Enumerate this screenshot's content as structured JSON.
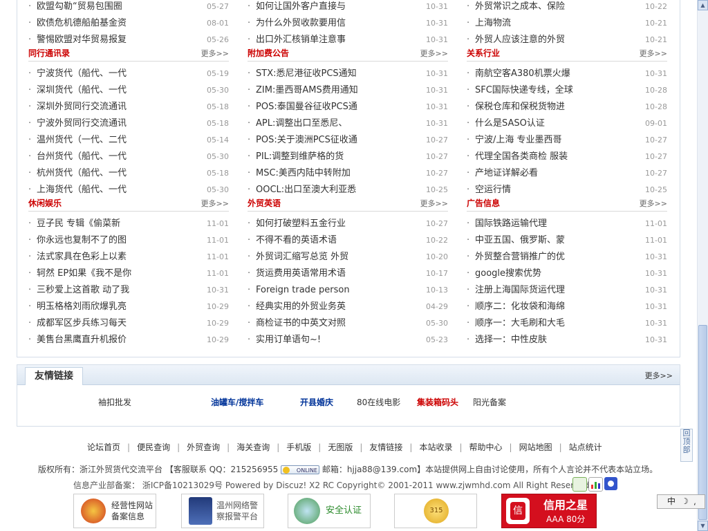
{
  "sections": {
    "col1_top": [
      {
        "title": "欧盟勾勒“贸易包围圈",
        "date": "05-27"
      },
      {
        "title": "欧债危机德船舶基金资",
        "date": "08-01"
      },
      {
        "title": "警惕欧盟对华贸易报复",
        "date": "05-26"
      }
    ],
    "col2_top": [
      {
        "title": "如何让国外客户直接与",
        "date": "10-31"
      },
      {
        "title": "为什么外贸收款要用信",
        "date": "10-31"
      },
      {
        "title": "出口外汇核销单注意事",
        "date": "10-31"
      }
    ],
    "col3_top": [
      {
        "title": "外贸常识之成本、保险",
        "date": "10-22"
      },
      {
        "title": "上海物流",
        "date": "10-21"
      },
      {
        "title": "外贸人应该注意的外贸",
        "date": "10-21"
      }
    ],
    "col1_mid": {
      "title": "同行通讯录",
      "more": "更多>>",
      "items": [
        {
          "title": "宁波货代（船代、一代",
          "date": "05-19"
        },
        {
          "title": "深圳货代（船代、一代",
          "date": "05-30"
        },
        {
          "title": "深圳外贸同行交流通讯",
          "date": "05-18"
        },
        {
          "title": "宁波外贸同行交流通讯",
          "date": "05-18"
        },
        {
          "title": "温州货代（一代、二代",
          "date": "05-14"
        },
        {
          "title": "台州货代（船代、一代",
          "date": "05-30"
        },
        {
          "title": "杭州货代（船代、一代",
          "date": "05-18"
        },
        {
          "title": "上海货代（船代、一代",
          "date": "05-30"
        }
      ]
    },
    "col2_mid": {
      "title": "附加费公告",
      "more": "更多>>",
      "items": [
        {
          "title": "STX:悉尼港征收PCS通知",
          "date": "10-31"
        },
        {
          "title": "ZIM:墨西哥AMS费用通知",
          "date": "10-31"
        },
        {
          "title": "POS:泰国曼谷征收PCS通",
          "date": "10-31"
        },
        {
          "title": "APL:调整出口至悉尼、",
          "date": "10-31"
        },
        {
          "title": "POS:关于澳洲PCS征收通",
          "date": "10-27"
        },
        {
          "title": "PIL:调整到维萨格的货",
          "date": "10-27"
        },
        {
          "title": "MSC:美西内陆中转附加",
          "date": "10-27"
        },
        {
          "title": "OOCL:出口至澳大利亚悉",
          "date": "10-25"
        }
      ]
    },
    "col3_mid": {
      "title": "关系行业",
      "more": "更多>>",
      "items": [
        {
          "title": "南航空客A380机票火爆",
          "date": "10-31"
        },
        {
          "title": "SFC国际快递专线，全球",
          "date": "10-28"
        },
        {
          "title": "保税仓库和保税货物进",
          "date": "10-28"
        },
        {
          "title": "什么是SASO认证",
          "date": "09-01"
        },
        {
          "title": "宁波/上海  专业墨西哥",
          "date": "10-27"
        },
        {
          "title": "代理全国各类商检  服装",
          "date": "10-27"
        },
        {
          "title": "产地证详解必看",
          "date": "10-27"
        },
        {
          "title": "空运行情",
          "date": "10-25"
        }
      ]
    },
    "col1_bot": {
      "title": "休闲娱乐",
      "more": "更多>>",
      "items": [
        {
          "title": "豆子民  专辑《偷菜新",
          "date": "11-01"
        },
        {
          "title": "你永远也复制不了的图",
          "date": "11-01"
        },
        {
          "title": "法式家具在色彩上以素",
          "date": "11-01"
        },
        {
          "title": "轲然  EP如果《我不是你",
          "date": "11-01"
        },
        {
          "title": "三秒爱上这首歌  动了我",
          "date": "10-31"
        },
        {
          "title": "明玉格格刘雨欣爆乳亮",
          "date": "10-29"
        },
        {
          "title": "成都军区步兵练习每天",
          "date": "10-29"
        },
        {
          "title": "美售台黑鹰直升机报价",
          "date": "10-29"
        }
      ]
    },
    "col2_bot": {
      "title": "外贸英语",
      "more": "更多>>",
      "items": [
        {
          "title": "如何打破塑料五金行业",
          "date": "10-27"
        },
        {
          "title": "不得不看的英语术语",
          "date": "10-22"
        },
        {
          "title": "外贸词汇缩写总览  外贸",
          "date": "10-20"
        },
        {
          "title": "货运费用英语常用术语",
          "date": "10-17"
        },
        {
          "title": "Foreign trade person",
          "date": "10-13"
        },
        {
          "title": "经典实用的外贸业务英",
          "date": "04-29"
        },
        {
          "title": "商检证书的中英文对照",
          "date": "05-30"
        },
        {
          "title": "实用订单语句~!",
          "date": "05-23"
        }
      ]
    },
    "col3_bot": {
      "title": "广告信息",
      "more": "更多>>",
      "items": [
        {
          "title": "国际铁路运输代理",
          "date": "11-01"
        },
        {
          "title": "中亚五国、俄罗斯、蒙",
          "date": "11-01"
        },
        {
          "title": "外贸整合营销推广的优",
          "date": "10-31"
        },
        {
          "title": "google搜索优势",
          "date": "10-31"
        },
        {
          "title": "注册上海国际货运代理",
          "date": "10-31"
        },
        {
          "title": "顺序二：化妆袋和海绵",
          "date": "10-31"
        },
        {
          "title": "顺序一：大毛刷和大毛",
          "date": "10-31"
        },
        {
          "title": "选择一：中性皮肤",
          "date": "10-31"
        }
      ]
    }
  },
  "friend_links": {
    "title": "友情链接",
    "more": "更多>>",
    "links": [
      {
        "label": "袖扣批发",
        "color": "#333333",
        "bold": false
      },
      {
        "label": "油罐车/搅拌车",
        "color": "#003399",
        "bold": true
      },
      {
        "label": "开县婚庆",
        "color": "#003399",
        "bold": true
      },
      {
        "label": "80在线电影",
        "color": "#333333",
        "bold": false
      },
      {
        "label": "集装箱码头",
        "color": "#cc0000",
        "bold": true
      },
      {
        "label": "阳光备案",
        "color": "#333333",
        "bold": false
      }
    ]
  },
  "footer": {
    "nav": [
      "论坛首页",
      "便民查询",
      "外贸查询",
      "海关查询",
      "手机版",
      "无图版",
      "友情链接",
      "本站收录",
      "帮助中心",
      "网站地图",
      "站点统计"
    ],
    "copyright_prefix": "版权所有：浙江外贸货代交流平台   【客服联系  QQ：215256955",
    "online_label": "ONLINE",
    "copyright_suffix": "邮箱：hjja88@139.com】本站提供网上自由讨论使用，所有个人言论并不代表本站立场。",
    "icp": "信息产业部备案：  浙ICP备10213029号  Powered by Discuz! X2 RC Copyright© 2001-2011 www.zjwmhd.com All Right Reserved",
    "badges": [
      {
        "label": "经营性网站\n备案信息"
      },
      {
        "label": "温州网络警\n察报警平台"
      },
      {
        "label": "安全认证"
      },
      {
        "label": "315"
      },
      {
        "label": "信用之星",
        "sub": "AAA  80分"
      }
    ]
  },
  "back_to_top": "回顶部",
  "ime": "中"
}
